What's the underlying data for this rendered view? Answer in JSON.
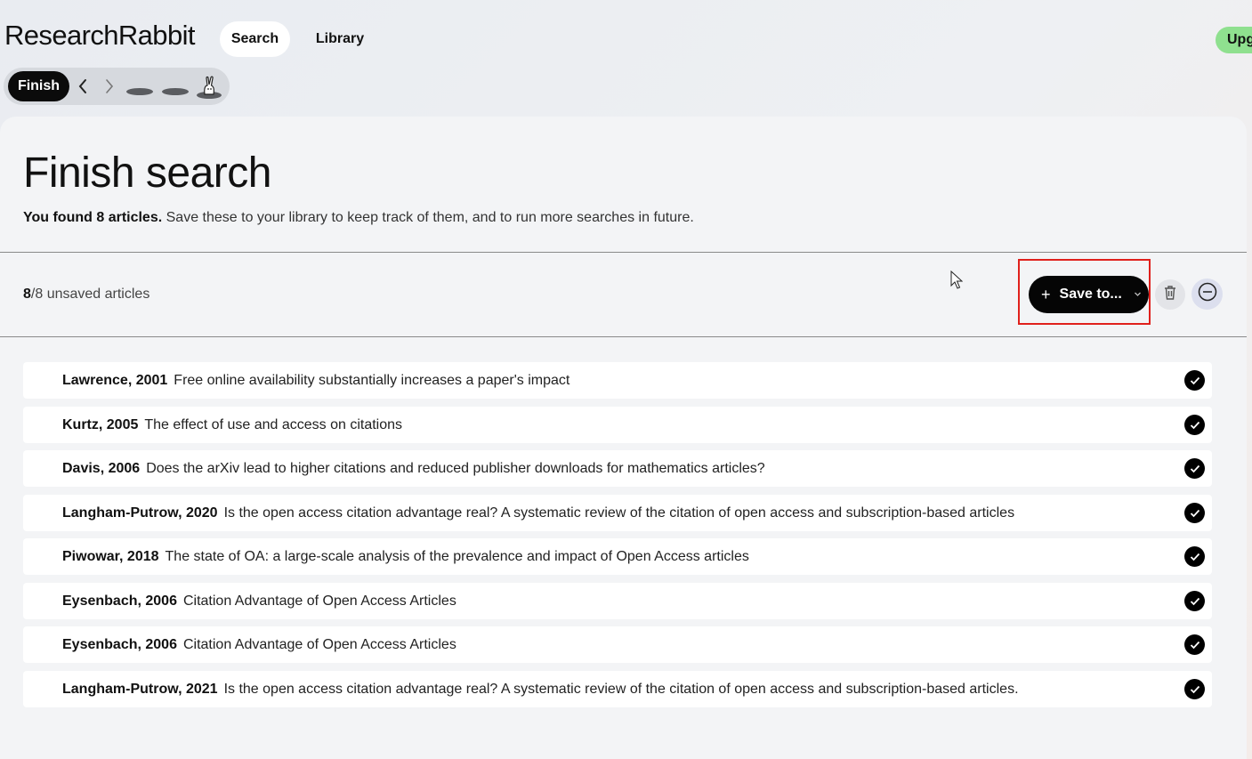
{
  "app": {
    "brand": "ResearchRabbit",
    "upgrade_label": "Upg"
  },
  "nav": {
    "tabs": [
      {
        "label": "Search"
      },
      {
        "label": "Library"
      }
    ]
  },
  "stepbar": {
    "current_label": "Finish"
  },
  "main": {
    "title": "Finish search",
    "subtitle_bold": "You found 8 articles.",
    "subtitle_rest": " Save these to your library to keep track of them, and to run more searches in future.",
    "count_current": "8",
    "count_rest": "/8 unsaved articles",
    "save_label": "Save to..."
  },
  "articles": [
    {
      "author": "Lawrence, 2001",
      "title": "Free online availability substantially increases a paper's impact"
    },
    {
      "author": "Kurtz, 2005",
      "title": "The effect of use and access on citations"
    },
    {
      "author": "Davis, 2006",
      "title": "Does the arXiv lead to higher citations and reduced publisher downloads for mathematics articles?"
    },
    {
      "author": "Langham-Putrow, 2020",
      "title": "Is the open access citation advantage real? A systematic review of the citation of open access and subscription-based articles"
    },
    {
      "author": "Piwowar, 2018",
      "title": "The state of OA: a large-scale analysis of the prevalence and impact of Open Access articles"
    },
    {
      "author": "Eysenbach, 2006",
      "title": "Citation Advantage of Open Access Articles"
    },
    {
      "author": "Eysenbach, 2006",
      "title": "Citation Advantage of Open Access Articles"
    },
    {
      "author": "Langham-Putrow, 2021",
      "title": "Is the open access citation advantage real? A systematic review of the citation of open access and subscription-based articles."
    }
  ],
  "colors": {
    "accent_upgrade": "#8fe08f",
    "highlight_box": "#e0201c",
    "primary_button": "#050505"
  },
  "icons": [
    "chevron-left-icon",
    "chevron-right-icon",
    "rabbit-icon",
    "plus-icon",
    "chevron-down-icon",
    "trash-icon",
    "minus-circle-icon",
    "check-icon",
    "cursor-icon"
  ]
}
